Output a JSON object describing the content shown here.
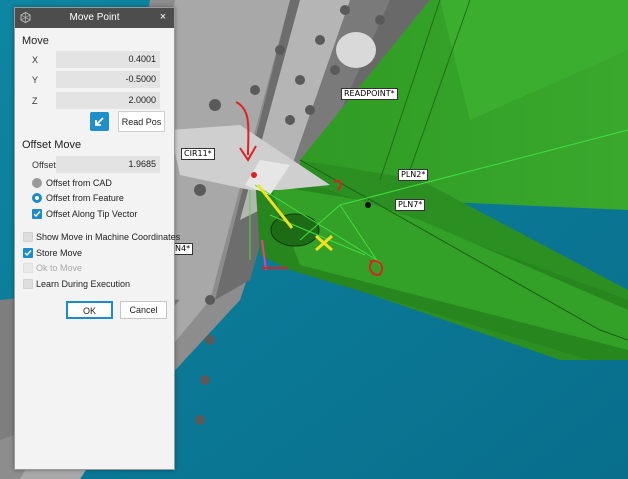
{
  "dialog": {
    "title": "Move Point",
    "close_glyph": "×",
    "move_section": "Move",
    "x_label": "X",
    "x_value": "0.4001",
    "y_label": "Y",
    "y_value": "-0.5000",
    "z_label": "Z",
    "z_value": "2.0000",
    "read_pos_label": "Read Pos",
    "offset_section": "Offset Move",
    "offset_label": "Offset",
    "offset_value": "1.9685",
    "offset_from_cad": "Offset from CAD",
    "offset_from_feature": "Offset from Feature",
    "offset_along_tip": "Offset Along Tip Vector",
    "show_move_machine": "Show Move in Machine Coordinates",
    "store_move": "Store Move",
    "ok_to_move": "Ok to Move",
    "learn_during_execution": "Learn During Execution",
    "ok_label": "OK",
    "cancel_label": "Cancel"
  },
  "state": {
    "offset_from_cad": false,
    "offset_from_feature": true,
    "offset_along_tip": true,
    "show_move_machine": false,
    "store_move": true,
    "ok_to_move": false,
    "learn_during_execution": false
  },
  "viewport": {
    "background": "#0d7a96",
    "callouts": {
      "readpoint": "READPOINT*",
      "cir11": "CIR11*",
      "pln2": "PLN2*",
      "pln7": "PLN7*",
      "pln4": "N4*"
    },
    "icons": [
      "app-icon",
      "read-pos-icon",
      "close-icon"
    ]
  }
}
